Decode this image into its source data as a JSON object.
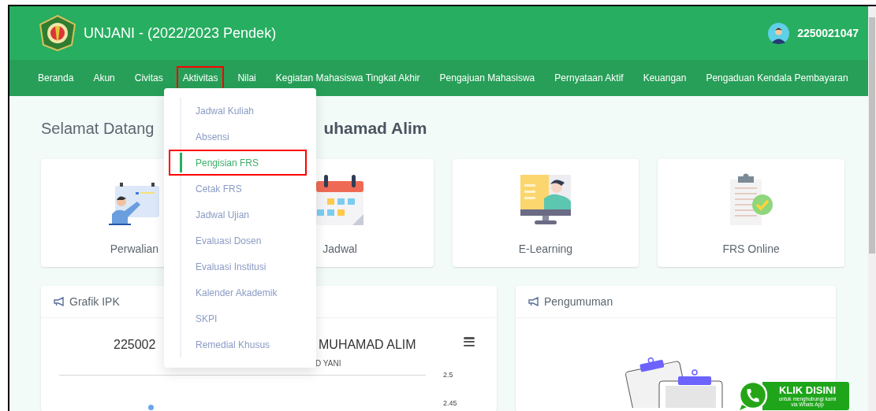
{
  "header": {
    "title": "UNJANI - (2022/2023 Pendek)",
    "user_id": "2250021047"
  },
  "nav": [
    {
      "label": "Beranda",
      "highlighted": false
    },
    {
      "label": "Akun",
      "highlighted": false
    },
    {
      "label": "Civitas",
      "highlighted": false
    },
    {
      "label": "Aktivitas",
      "highlighted": true
    },
    {
      "label": "Nilai",
      "highlighted": false
    },
    {
      "label": "Kegiatan Mahasiswa Tingkat Akhir",
      "highlighted": false
    },
    {
      "label": "Pengajuan Mahasiswa",
      "highlighted": false
    },
    {
      "label": "Pernyataan Aktif",
      "highlighted": false
    },
    {
      "label": "Keuangan",
      "highlighted": false
    },
    {
      "label": "Pengaduan Kendala Pembayaran",
      "highlighted": false
    }
  ],
  "dropdown": [
    {
      "label": "Jadwal Kuliah",
      "selected": false,
      "highlighted": false
    },
    {
      "label": "Absensi",
      "selected": false,
      "highlighted": false
    },
    {
      "label": "Pengisian FRS",
      "selected": true,
      "highlighted": true
    },
    {
      "label": "Cetak FRS",
      "selected": false,
      "highlighted": false
    },
    {
      "label": "Jadwal Ujian",
      "selected": false,
      "highlighted": false
    },
    {
      "label": "Evaluasi Dosen",
      "selected": false,
      "highlighted": false
    },
    {
      "label": "Evaluasi Institusi",
      "selected": false,
      "highlighted": false
    },
    {
      "label": "Kalender Akademik",
      "selected": false,
      "highlighted": false
    },
    {
      "label": "SKPI",
      "selected": false,
      "highlighted": false
    },
    {
      "label": "Remedial Khusus",
      "selected": false,
      "highlighted": false
    }
  ],
  "welcome": [
    "Selamat Datang",
    "uhamad Alim"
  ],
  "cards": [
    {
      "label": "Perwalian",
      "kind": "perwalian"
    },
    {
      "label": "Jadwal",
      "kind": "calendar"
    },
    {
      "label": "E-Learning",
      "kind": "elearning"
    },
    {
      "label": "FRS Online",
      "kind": "clipboard"
    }
  ],
  "grafik": {
    "title": "Grafik IPK",
    "chart_title_parts": [
      "225002",
      "MUHAMAD ALIM"
    ],
    "subtitle": "D YANI",
    "y_tick_labels": [
      "2.5",
      "2.45"
    ]
  },
  "pengumuman": {
    "title": "Pengumuman"
  },
  "whatsapp": {
    "headline": "KLIK DISINI",
    "line1": "untuk menghubungi kami",
    "line2": "via Whats App"
  }
}
